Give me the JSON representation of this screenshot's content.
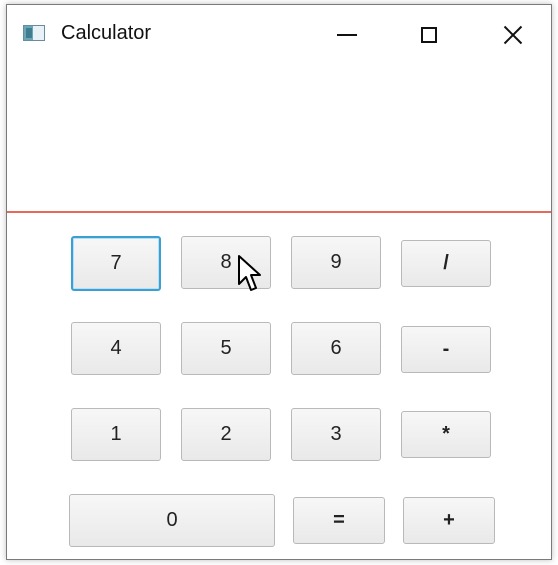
{
  "window": {
    "title": "Calculator"
  },
  "display": {
    "value": ""
  },
  "keys": {
    "k7": "7",
    "k8": "8",
    "k9": "9",
    "div": "/",
    "k4": "4",
    "k5": "5",
    "k6": "6",
    "sub": "-",
    "k1": "1",
    "k2": "2",
    "k3": "3",
    "mul": "*",
    "k0": "0",
    "eq": "=",
    "add": "+"
  },
  "colors": {
    "display_underline": "#e66a5a",
    "focus_border": "#3aa0d4"
  },
  "icons": {
    "app": "calculator-app-icon",
    "minimize": "minimize-icon",
    "maximize": "maximize-icon",
    "close": "close-icon",
    "pointer": "mouse-pointer-icon"
  }
}
